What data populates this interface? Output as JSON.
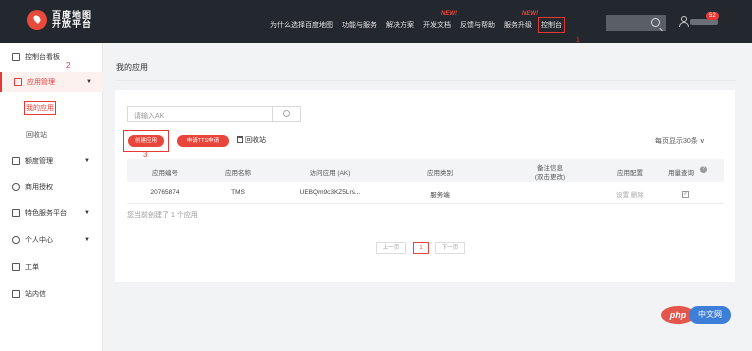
{
  "brand": {
    "line1": "百度地图",
    "line2": "开放平台"
  },
  "nav": {
    "items": [
      "为什么选择百度地图",
      "功能与服务",
      "解决方案",
      "开发文档",
      "反馈与帮助",
      "服务升级",
      "控制台"
    ],
    "new_label": "NEW!",
    "badge_count": "52"
  },
  "annotations": {
    "n1": "1",
    "n2": "2",
    "n3": "3"
  },
  "sidebar": {
    "dashboard": "控制台看板",
    "app_manage": "应用管理",
    "my_apps": "我的应用",
    "recycle_bin": "回收站",
    "quota": "额度管理",
    "commercial": "商用授权",
    "special": "特色服务平台",
    "personal": "个人中心",
    "ticket": "工单",
    "inbox": "站内信"
  },
  "main": {
    "title": "我的应用",
    "ak_placeholder": "请输入AK",
    "create_btn": "创建应用",
    "tts_btn": "申请TTS申请",
    "recycle": "回收站",
    "per_page": "每页显示30条 ∨"
  },
  "table": {
    "headers": [
      "应用编号",
      "应用名称",
      "访问应用 (AK)",
      "应用类别",
      "备注信息",
      "(双击更改)",
      "应用配置",
      "用量查询"
    ],
    "rows": [
      {
        "id": "20765874",
        "name": "TMS",
        "ak": "UEBQm9c3KZ5Lrs...",
        "type": "服务端",
        "config": "设置 删除",
        "check": "✓"
      }
    ],
    "summary": "您当前创建了 1 个应用"
  },
  "pagination": {
    "prev": "上一页",
    "current": "1",
    "next": "下一页"
  },
  "watermark": {
    "a": "php",
    "b": "中文网"
  },
  "colors": {
    "accent": "#e8463b",
    "nav_bg": "#23272e"
  }
}
